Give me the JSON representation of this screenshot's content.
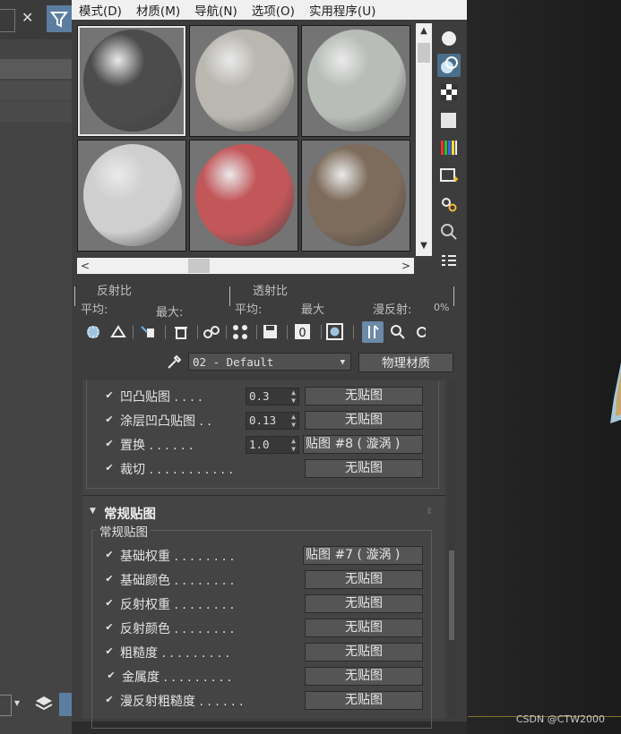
{
  "menu": {
    "items": [
      "模式(D)",
      "材质(M)",
      "导航(N)",
      "选项(O)",
      "实用程序(U)"
    ]
  },
  "host": {
    "close_glyph": "✕",
    "filter_icon": "funnel-icon",
    "bottom_dropdown_arrow": "▾"
  },
  "slots": [
    {
      "color": "#4c4c4c",
      "active": true
    },
    {
      "color": "#b9b7b0",
      "active": false
    },
    {
      "color": "#b8bdb8",
      "active": false
    },
    {
      "color": "#cfcfcf",
      "active": false
    },
    {
      "color": "#c2575a",
      "active": false
    },
    {
      "color": "#7d6b5b",
      "active": false
    }
  ],
  "scroll": {
    "left": "<",
    "right": ">",
    "up": "▲",
    "down": "▼"
  },
  "stats": {
    "reflect_title": "反射比",
    "transmit_title": "透射比",
    "avg1": "平均:",
    "max1": "最大:",
    "avg2": "平均:",
    "max2": "最大",
    "diffuse": "漫反射:",
    "diffuse_value": "0%"
  },
  "material": {
    "name": "02 - Default",
    "type_button": "物理材质"
  },
  "special_maps": [
    {
      "label": "凹凸贴图 . . . .",
      "value": "0.3",
      "map": "无贴图"
    },
    {
      "label": "涂层凹凸贴图 . .",
      "value": "0.13",
      "map": "无贴图"
    },
    {
      "label": "置换 . . . . . .",
      "value": "1.0",
      "map": "贴图 #8  ( 漩涡 )"
    },
    {
      "label": "裁切 . . . . . . . . . . .",
      "value": "",
      "map": "无贴图"
    }
  ],
  "general_maps": {
    "rollout_title": "常规贴图",
    "group_title": "常规贴图",
    "rows": [
      {
        "label": "基础权重 . . . . . . . .",
        "map": "贴图 #7  ( 漩涡 )"
      },
      {
        "label": "基础颜色 . . . . . . . .",
        "map": "无贴图"
      },
      {
        "label": "反射权重 . . . . . . . .",
        "map": "无贴图"
      },
      {
        "label": "反射颜色 . . . . . . . .",
        "map": "无贴图"
      },
      {
        "label": "粗糙度 . . . . . . . . .",
        "map": "无贴图"
      },
      {
        "label": "金属度 . . . . . . . . .",
        "map": "无贴图"
      },
      {
        "label": "漫反射粗糙度 . . . . . .",
        "map": "无贴图"
      }
    ]
  },
  "watermark": "CSDN @CTW2000",
  "check_glyph": "✔"
}
